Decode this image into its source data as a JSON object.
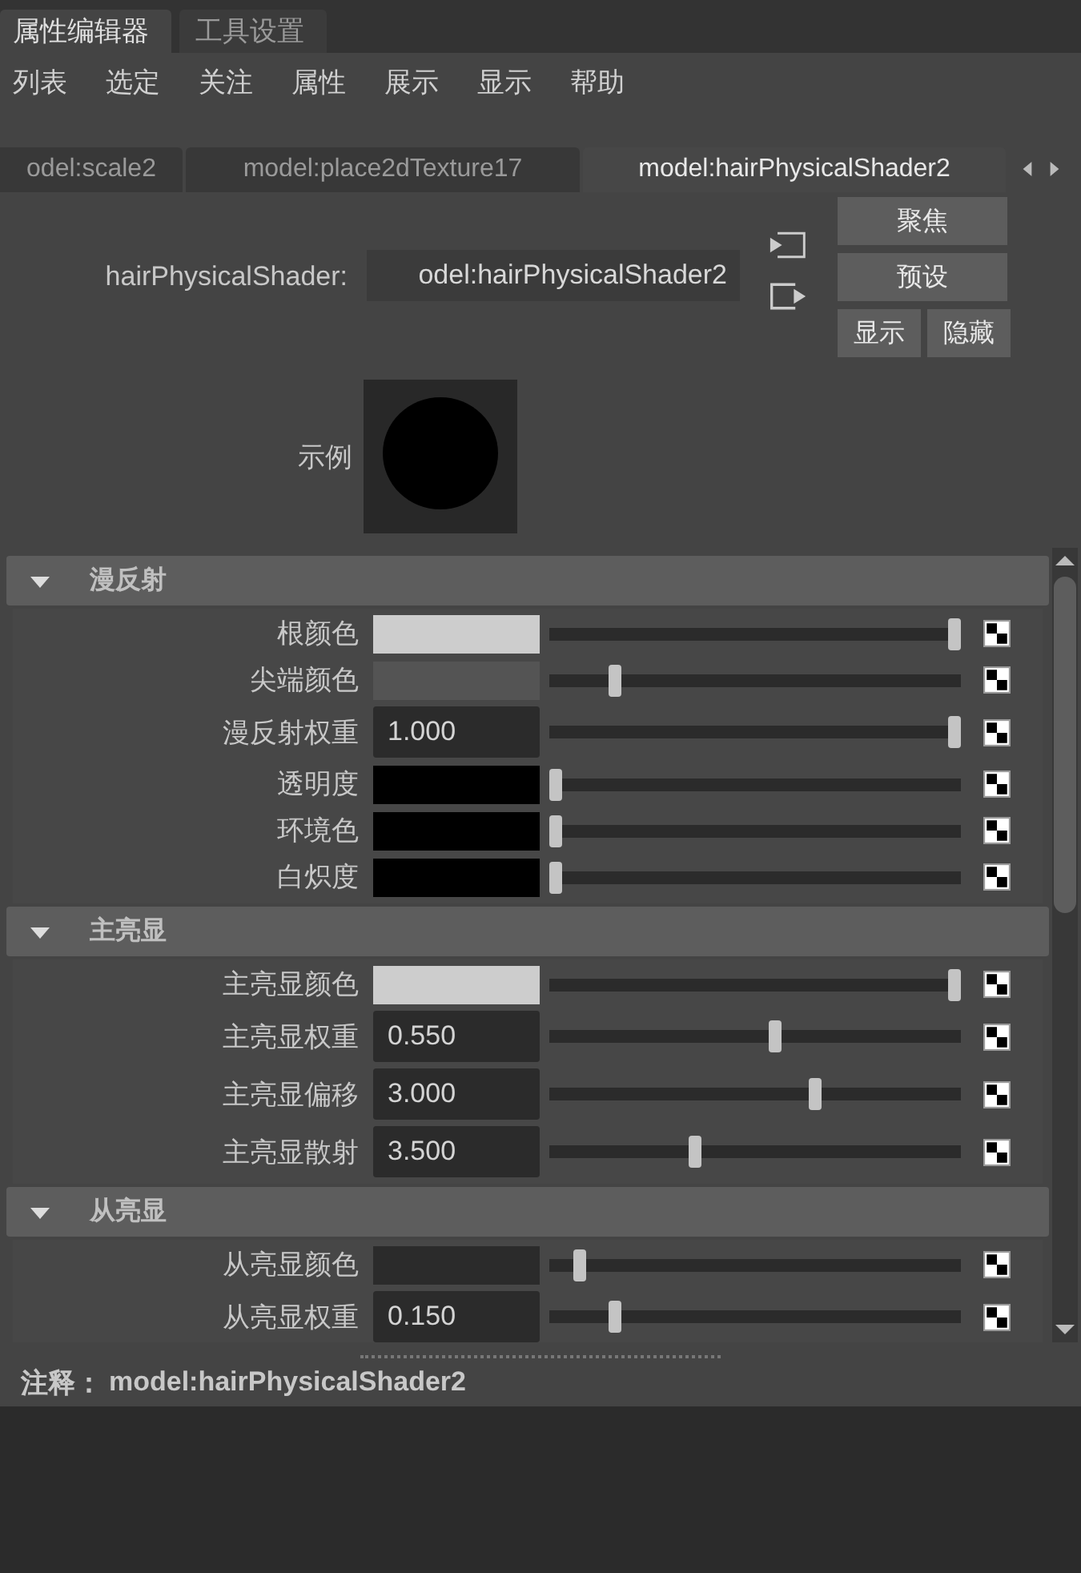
{
  "window_tabs": [
    {
      "label": "属性编辑器",
      "selected": true
    },
    {
      "label": "工具设置",
      "selected": false
    }
  ],
  "menu": [
    "列表",
    "选定",
    "关注",
    "属性",
    "展示",
    "显示",
    "帮助"
  ],
  "node_tabs": [
    {
      "label": "odel:scale2",
      "selected": false
    },
    {
      "label": "model:place2dTexture17",
      "selected": false
    },
    {
      "label": "model:hairPhysicalShader2",
      "selected": true
    }
  ],
  "node": {
    "type_label": "hairPhysicalShader:",
    "name": "odel:hairPhysicalShader2",
    "buttons": [
      "聚焦",
      "预设",
      "显示",
      "隐藏"
    ]
  },
  "sample": {
    "label": "示例"
  },
  "sections": [
    {
      "title": "漫反射",
      "expanded": true,
      "attributes": [
        {
          "kind": "color",
          "label": "根颜色",
          "color": "#cdcdcd",
          "level": 1
        },
        {
          "kind": "color",
          "label": "尖端颜色",
          "color": "#545454",
          "level": 0.15
        },
        {
          "kind": "number",
          "label": "漫反射权重",
          "value": "1.000",
          "level": 1
        },
        {
          "kind": "color",
          "label": "透明度",
          "color": "#000000",
          "level": 0
        },
        {
          "kind": "color",
          "label": "环境色",
          "color": "#000000",
          "level": 0
        },
        {
          "kind": "color",
          "label": "白炽度",
          "color": "#000000",
          "level": 0
        }
      ]
    },
    {
      "title": "主亮显",
      "expanded": true,
      "attributes": [
        {
          "kind": "color",
          "label": "主亮显颜色",
          "color": "#cdcdcd",
          "level": 1
        },
        {
          "kind": "number",
          "label": "主亮显权重",
          "value": "0.550",
          "level": 0.55
        },
        {
          "kind": "number",
          "label": "主亮显偏移",
          "value": "3.000",
          "level": 0.65
        },
        {
          "kind": "number",
          "label": "主亮显散射",
          "value": "3.500",
          "level": 0.35
        }
      ]
    },
    {
      "title": "从亮显",
      "expanded": true,
      "attributes": [
        {
          "kind": "color",
          "label": "从亮显颜色",
          "color": "#2b2b2b",
          "level": 0.06
        },
        {
          "kind": "number",
          "label": "从亮显权重",
          "value": "0.150",
          "level": 0.15
        }
      ]
    }
  ],
  "note": {
    "label": "注释：",
    "value": "model:hairPhysicalShader2"
  }
}
